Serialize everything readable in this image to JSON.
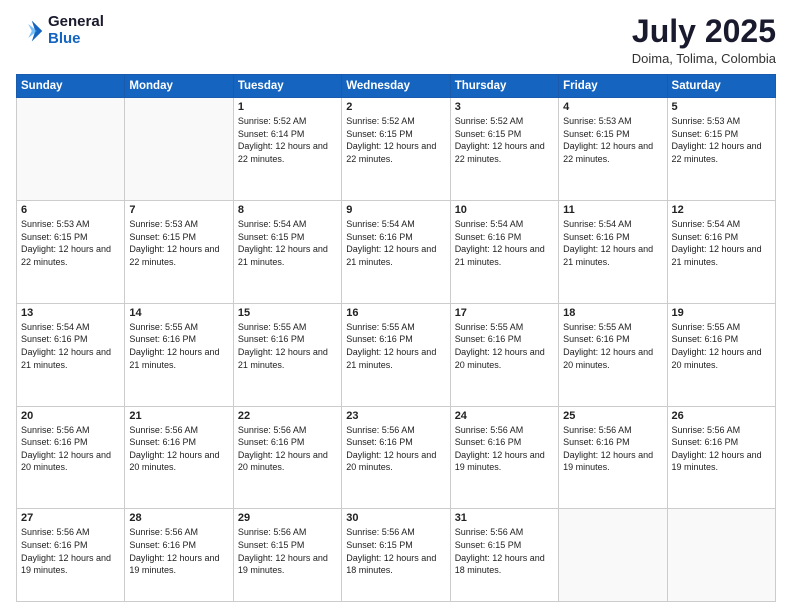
{
  "logo": {
    "general": "General",
    "blue": "Blue"
  },
  "header": {
    "month_year": "July 2025",
    "location": "Doima, Tolima, Colombia"
  },
  "weekdays": [
    "Sunday",
    "Monday",
    "Tuesday",
    "Wednesday",
    "Thursday",
    "Friday",
    "Saturday"
  ],
  "weeks": [
    [
      {
        "day": "",
        "info": ""
      },
      {
        "day": "",
        "info": ""
      },
      {
        "day": "1",
        "info": "Sunrise: 5:52 AM\nSunset: 6:14 PM\nDaylight: 12 hours and 22 minutes."
      },
      {
        "day": "2",
        "info": "Sunrise: 5:52 AM\nSunset: 6:15 PM\nDaylight: 12 hours and 22 minutes."
      },
      {
        "day": "3",
        "info": "Sunrise: 5:52 AM\nSunset: 6:15 PM\nDaylight: 12 hours and 22 minutes."
      },
      {
        "day": "4",
        "info": "Sunrise: 5:53 AM\nSunset: 6:15 PM\nDaylight: 12 hours and 22 minutes."
      },
      {
        "day": "5",
        "info": "Sunrise: 5:53 AM\nSunset: 6:15 PM\nDaylight: 12 hours and 22 minutes."
      }
    ],
    [
      {
        "day": "6",
        "info": "Sunrise: 5:53 AM\nSunset: 6:15 PM\nDaylight: 12 hours and 22 minutes."
      },
      {
        "day": "7",
        "info": "Sunrise: 5:53 AM\nSunset: 6:15 PM\nDaylight: 12 hours and 22 minutes."
      },
      {
        "day": "8",
        "info": "Sunrise: 5:54 AM\nSunset: 6:15 PM\nDaylight: 12 hours and 21 minutes."
      },
      {
        "day": "9",
        "info": "Sunrise: 5:54 AM\nSunset: 6:16 PM\nDaylight: 12 hours and 21 minutes."
      },
      {
        "day": "10",
        "info": "Sunrise: 5:54 AM\nSunset: 6:16 PM\nDaylight: 12 hours and 21 minutes."
      },
      {
        "day": "11",
        "info": "Sunrise: 5:54 AM\nSunset: 6:16 PM\nDaylight: 12 hours and 21 minutes."
      },
      {
        "day": "12",
        "info": "Sunrise: 5:54 AM\nSunset: 6:16 PM\nDaylight: 12 hours and 21 minutes."
      }
    ],
    [
      {
        "day": "13",
        "info": "Sunrise: 5:54 AM\nSunset: 6:16 PM\nDaylight: 12 hours and 21 minutes."
      },
      {
        "day": "14",
        "info": "Sunrise: 5:55 AM\nSunset: 6:16 PM\nDaylight: 12 hours and 21 minutes."
      },
      {
        "day": "15",
        "info": "Sunrise: 5:55 AM\nSunset: 6:16 PM\nDaylight: 12 hours and 21 minutes."
      },
      {
        "day": "16",
        "info": "Sunrise: 5:55 AM\nSunset: 6:16 PM\nDaylight: 12 hours and 21 minutes."
      },
      {
        "day": "17",
        "info": "Sunrise: 5:55 AM\nSunset: 6:16 PM\nDaylight: 12 hours and 20 minutes."
      },
      {
        "day": "18",
        "info": "Sunrise: 5:55 AM\nSunset: 6:16 PM\nDaylight: 12 hours and 20 minutes."
      },
      {
        "day": "19",
        "info": "Sunrise: 5:55 AM\nSunset: 6:16 PM\nDaylight: 12 hours and 20 minutes."
      }
    ],
    [
      {
        "day": "20",
        "info": "Sunrise: 5:56 AM\nSunset: 6:16 PM\nDaylight: 12 hours and 20 minutes."
      },
      {
        "day": "21",
        "info": "Sunrise: 5:56 AM\nSunset: 6:16 PM\nDaylight: 12 hours and 20 minutes."
      },
      {
        "day": "22",
        "info": "Sunrise: 5:56 AM\nSunset: 6:16 PM\nDaylight: 12 hours and 20 minutes."
      },
      {
        "day": "23",
        "info": "Sunrise: 5:56 AM\nSunset: 6:16 PM\nDaylight: 12 hours and 20 minutes."
      },
      {
        "day": "24",
        "info": "Sunrise: 5:56 AM\nSunset: 6:16 PM\nDaylight: 12 hours and 19 minutes."
      },
      {
        "day": "25",
        "info": "Sunrise: 5:56 AM\nSunset: 6:16 PM\nDaylight: 12 hours and 19 minutes."
      },
      {
        "day": "26",
        "info": "Sunrise: 5:56 AM\nSunset: 6:16 PM\nDaylight: 12 hours and 19 minutes."
      }
    ],
    [
      {
        "day": "27",
        "info": "Sunrise: 5:56 AM\nSunset: 6:16 PM\nDaylight: 12 hours and 19 minutes."
      },
      {
        "day": "28",
        "info": "Sunrise: 5:56 AM\nSunset: 6:16 PM\nDaylight: 12 hours and 19 minutes."
      },
      {
        "day": "29",
        "info": "Sunrise: 5:56 AM\nSunset: 6:15 PM\nDaylight: 12 hours and 19 minutes."
      },
      {
        "day": "30",
        "info": "Sunrise: 5:56 AM\nSunset: 6:15 PM\nDaylight: 12 hours and 18 minutes."
      },
      {
        "day": "31",
        "info": "Sunrise: 5:56 AM\nSunset: 6:15 PM\nDaylight: 12 hours and 18 minutes."
      },
      {
        "day": "",
        "info": ""
      },
      {
        "day": "",
        "info": ""
      }
    ]
  ]
}
